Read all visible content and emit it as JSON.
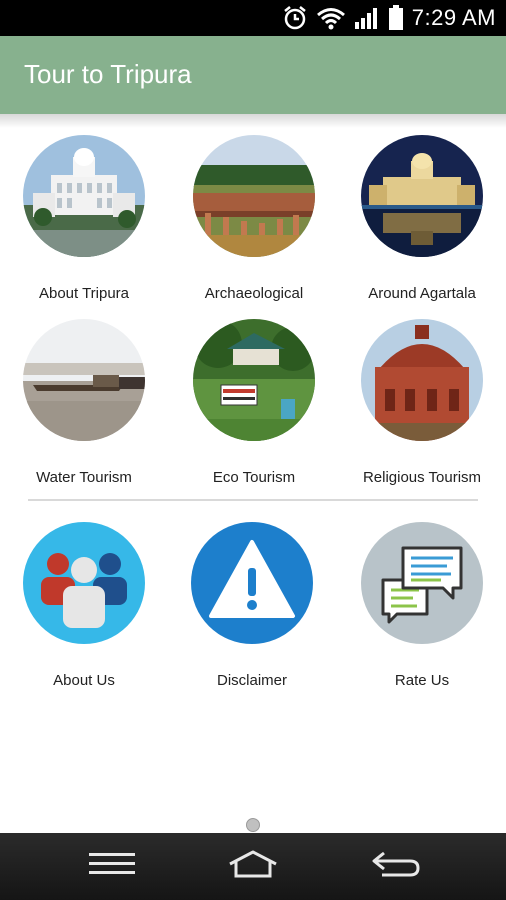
{
  "status_bar": {
    "time": "7:29 AM",
    "icons": [
      "alarm-icon",
      "wifi-icon",
      "signal-icon",
      "battery-icon"
    ]
  },
  "app_bar": {
    "title": "Tour to Tripura",
    "color": "#87b18e"
  },
  "tiles": [
    {
      "label": "About Tripura",
      "image": "white-palace-photo"
    },
    {
      "label": "Archaeological",
      "image": "ruins-photo"
    },
    {
      "label": "Around Agartala",
      "image": "palace-night-photo"
    },
    {
      "label": "Water Tourism",
      "image": "boat-river-photo"
    },
    {
      "label": "Eco Tourism",
      "image": "eco-park-photo"
    },
    {
      "label": "Religious Tourism",
      "image": "red-temple-photo"
    }
  ],
  "secondary_tiles": [
    {
      "label": "About Us",
      "icon": "people-icon"
    },
    {
      "label": "Disclaimer",
      "icon": "warning-icon"
    },
    {
      "label": "Rate Us",
      "icon": "chat-bubbles-icon"
    }
  ],
  "nav_bar": {
    "icons": [
      "menu-icon",
      "home-icon",
      "back-icon"
    ]
  }
}
